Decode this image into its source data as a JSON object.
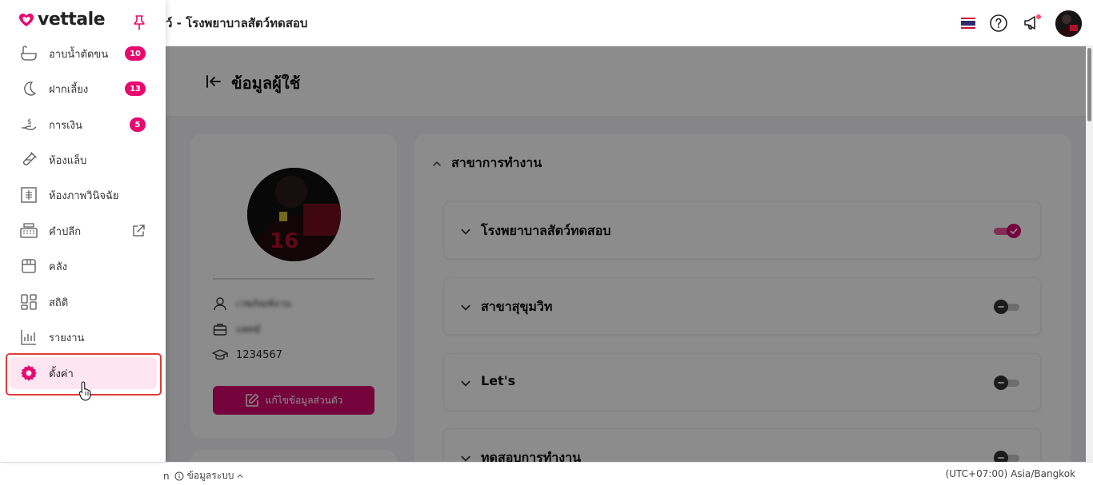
{
  "brand": {
    "logo_text": "vettale",
    "accent": "#e8086f"
  },
  "topbar": {
    "title": "ว์ - โรงพยาบาลสัตว์ทดสอบ",
    "icons": [
      "thai-flag-icon",
      "help-icon",
      "announcement-icon",
      "user-avatar"
    ]
  },
  "sidebar": {
    "items": [
      {
        "label": "อาบน้ำตัดขน",
        "icon": "bathtub-icon",
        "badge": "10"
      },
      {
        "label": "ฝากเลี้ยง",
        "icon": "moon-icon",
        "badge": "13"
      },
      {
        "label": "การเงิน",
        "icon": "finance-hand-icon",
        "badge": "5"
      },
      {
        "label": "ห้องแล็บ",
        "icon": "test-tube-icon"
      },
      {
        "label": "ห้องภาพวินิจฉัย",
        "icon": "xray-icon"
      },
      {
        "label": "คำปลีก",
        "icon": "cash-register-icon",
        "external": "external-link-icon"
      },
      {
        "label": "คลัง",
        "icon": "box-icon"
      },
      {
        "label": "สถิติ",
        "icon": "dashboard-icon"
      },
      {
        "label": "รายงาน",
        "icon": "bar-chart-icon"
      },
      {
        "label": "ตั้งค่า",
        "icon": "gear-icon",
        "active": true
      }
    ]
  },
  "page": {
    "title": "ข้อมูลผู้ใช้",
    "profile": {
      "name_blurred": "เวชภัณฑ์งาน",
      "role_blurred": "แพทย์",
      "license": "1234567",
      "edit_label": "แก้ไขข้อมูลส่วนตัว"
    },
    "branches": {
      "heading": "สาขาการทำงาน",
      "items": [
        {
          "name": "โรงพยาบาลสัตว์ทดสอบ",
          "enabled": true
        },
        {
          "name": "สาขาสุขุมวิท",
          "enabled": false
        },
        {
          "name": "Let's",
          "enabled": false
        },
        {
          "name": "ทดสอบการทำงาน",
          "enabled": false
        }
      ]
    }
  },
  "footer": {
    "left_fragment": "n",
    "system_info": "ข้อมูลระบบ",
    "timezone": "(UTC+07:00) Asia/Bangkok"
  }
}
